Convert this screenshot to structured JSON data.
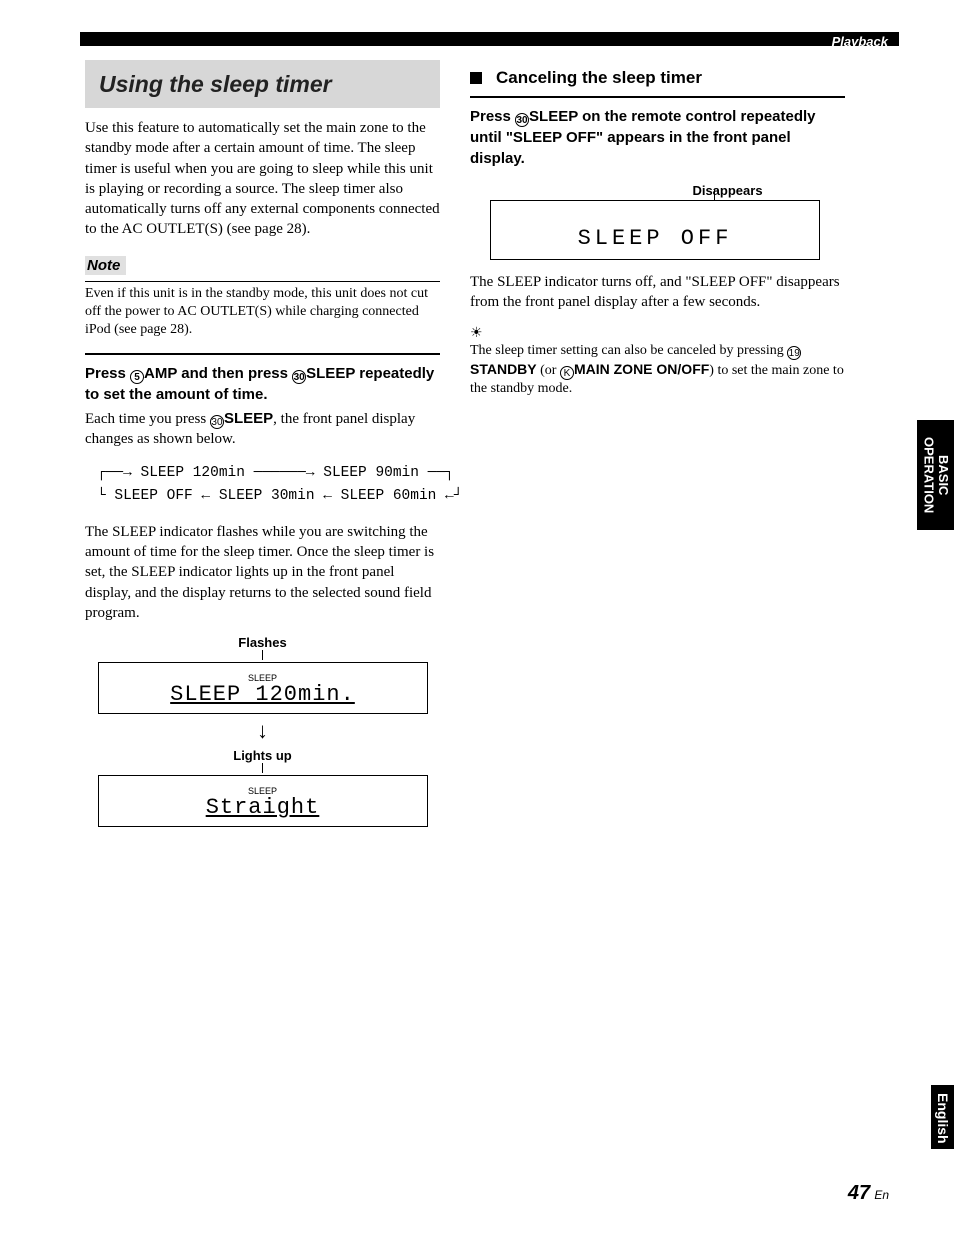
{
  "header": {
    "playback": "Playback"
  },
  "left": {
    "title": "Using the sleep timer",
    "intro": "Use this feature to automatically set the main zone to the standby mode after a certain amount of time. The sleep timer is useful when you are going to sleep while this unit is playing or recording a source. The sleep timer also automatically turns off any external components connected to the AC OUTLET(S) (see page 28).",
    "note_label": "Note",
    "note_body": "Even if this unit is in the standby mode, this unit does not cut off the power to AC OUTLET(S) while charging connected iPod (see page 28).",
    "press_pre": "Press ",
    "press_amp": "AMP",
    "press_mid": " and then press ",
    "press_sleep": "SLEEP",
    "press_post": " repeatedly to set the amount of time.",
    "each_press_pre": "Each time you press ",
    "each_press_ref": "SLEEP",
    "each_press_post": ", the front panel display changes as shown below.",
    "cycle": "┌──→ SLEEP 120min ──────→ SLEEP 90min ──┐\n└ SLEEP OFF ← SLEEP 30min ← SLEEP 60min ←┘",
    "indicator_para": "The SLEEP indicator flashes while you are switching the amount of time for the sleep timer. Once the sleep timer is set, the SLEEP indicator lights up in the front panel display, and the display returns to the selected sound field program.",
    "flashes_label": "Flashes",
    "sleep_icon_text": "SLEEP",
    "display1_text": "SLEEP 120min.",
    "lightsup_label": "Lights up",
    "display2_text": "Straight"
  },
  "right": {
    "cancel_title": "Canceling the sleep timer",
    "cancel_press_pre": "Press ",
    "cancel_press_ref": "SLEEP",
    "cancel_press_mid": " on the remote control repeatedly until \"SLEEP OFF\" appears in the front panel display.",
    "disappears_label": "Disappears",
    "off_display": "SLEEP   OFF",
    "off_para": "The SLEEP indicator turns off, and \"SLEEP OFF\" disappears from the front panel display after a few seconds.",
    "tip_pre": "The sleep timer setting can also be canceled by pressing ",
    "tip_standby": "STANDBY",
    "tip_mid": " (or ",
    "tip_zone": "MAIN ZONE ON/OFF",
    "tip_post": ") to set the main zone to the standby mode."
  },
  "tabs": {
    "basic": "BASIC\nOPERATION",
    "english": "English"
  },
  "page": {
    "num": "47",
    "suffix": "En"
  }
}
